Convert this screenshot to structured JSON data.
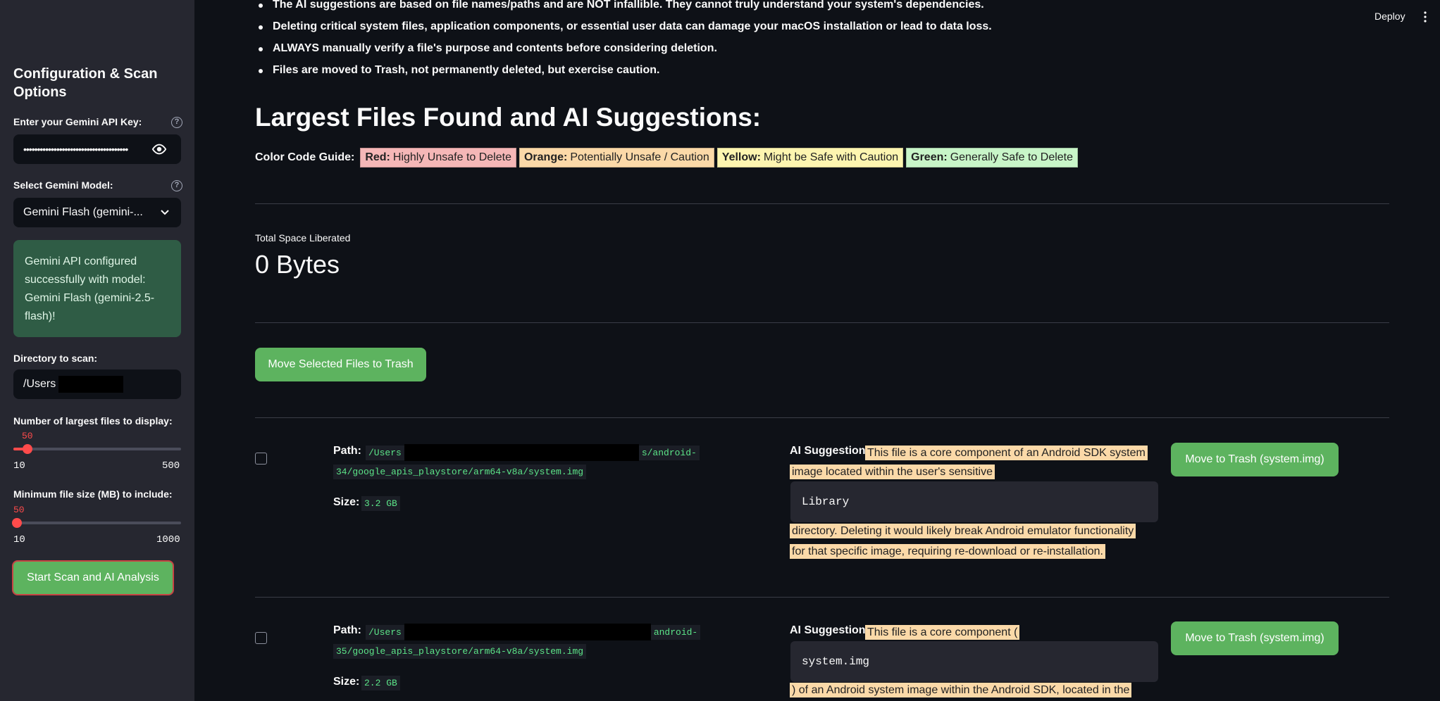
{
  "sidebar": {
    "title": "Configuration & Scan Options",
    "api_key_label": "Enter your Gemini API Key:",
    "api_key_value": "••••••••••••••••••••••••••••••••••••••",
    "model_label": "Select Gemini Model:",
    "model_value": "Gemini Flash (gemini-...",
    "success_message": "Gemini API configured successfully with model: Gemini Flash (gemini-2.5-flash)!",
    "directory_label": "Directory to scan:",
    "directory_value": "/Users",
    "num_files_label": "Number of largest files to display:",
    "num_files_value": 50,
    "num_files_min": "10",
    "num_files_max": "500",
    "min_size_label": "Minimum file size (MB) to include:",
    "min_size_value": 50,
    "min_size_min": "10",
    "min_size_max": "1000",
    "start_button": "Start Scan and AI Analysis"
  },
  "header": {
    "deploy": "Deploy",
    "menu_icon": "vertical-dots-icon"
  },
  "main": {
    "bullets": [
      "The AI suggestions are based on file names/paths and are NOT infallible. They cannot truly understand your system's dependencies.",
      "Deleting critical system files, application components, or essential user data can damage your macOS installation or lead to data loss.",
      "ALWAYS manually verify a file's purpose and contents before considering deletion.",
      "Files are moved to Trash, not permanently deleted, but exercise caution."
    ],
    "heading": "Largest Files Found and AI Suggestions:",
    "guide_label": "Color Code Guide:",
    "guide": [
      {
        "key": "Red:",
        "text": "Highly Unsafe to Delete",
        "color": "#f5b7b7"
      },
      {
        "key": "Orange:",
        "text": "Potentially Unsafe / Caution",
        "color": "#fbd9a8"
      },
      {
        "key": "Yellow:",
        "text": "Might be Safe with Caution",
        "color": "#fdf5b0"
      },
      {
        "key": "Green:",
        "text": "Generally Safe to Delete",
        "color": "#c8f5c8"
      }
    ],
    "metric_label": "Total Space Liberated",
    "metric_value": "0 Bytes",
    "move_selected_button": "Move Selected Files to Trash",
    "files": [
      {
        "path_label": "Path:",
        "path_line1_start": "/Users",
        "path_line1_end": "s/android-",
        "path_line2": "34/google_apis_playstore/arm64-v8a/system.img",
        "size_label": "Size:",
        "size": "3.2 GB",
        "ai_label": "AI Suggestion:",
        "suggestion_part1a": "This file is a core component of an Android SDK system",
        "suggestion_part1b": "image located within the user's sensitive",
        "suggestion_code": "Library",
        "suggestion_part2a": "directory. Deleting it would likely break Android emulator functionality",
        "suggestion_part2b": "for that specific image, requiring re-download or re-installation.",
        "button": "Move to Trash (system.img)"
      },
      {
        "path_label": "Path:",
        "path_line1_start": "/Users",
        "path_line1_end": "android-",
        "path_line2": "35/google_apis_playstore/arm64-v8a/system.img",
        "size_label": "Size:",
        "size": "2.2 GB",
        "ai_label": "AI Suggestion:",
        "suggestion_part1a": "This file is a core component (",
        "suggestion_code": "system.img",
        "suggestion_part2a": ") of an Android system image within the Android SDK, located in the",
        "button": "Move to Trash (system.img)"
      }
    ]
  },
  "colors": {
    "background": "#0e1117",
    "sidebar": "#262730",
    "primary_button": "#5db35f",
    "slider_accent": "#ff4b4b",
    "success_bg": "#2f5c45",
    "suggestion_orange": "#fbd9a8",
    "code_text": "#5ce488"
  }
}
